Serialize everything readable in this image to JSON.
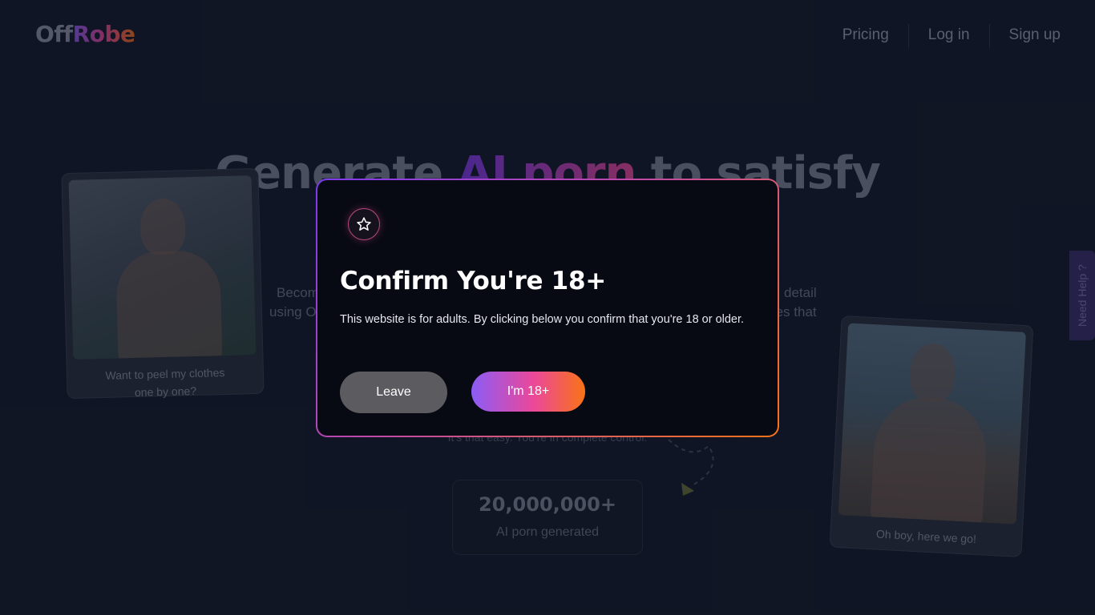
{
  "header": {
    "logo_part1": "Off",
    "logo_part2": "Robe",
    "nav": [
      {
        "label": "Pricing"
      },
      {
        "label": "Log in"
      },
      {
        "label": "Sign up"
      }
    ]
  },
  "hero": {
    "title_part1": "Generate ",
    "title_highlight": "AI porn",
    "title_part2": " to satisfy",
    "sub_left_line1": "Becom",
    "sub_left_line2": "using O",
    "sub_right_line1": "detail",
    "sub_right_line2": "ges that",
    "small_text": "It's that easy. You're in complete control."
  },
  "stat": {
    "value": "20,000,000+",
    "label": "AI porn generated"
  },
  "cards": {
    "left_caption_line1": "Want to peel my clothes",
    "left_caption_line2": "one by one?",
    "right_caption": "Oh boy, here we go!"
  },
  "help_tab": {
    "label": "Need Help ?"
  },
  "modal": {
    "icon": "star-icon",
    "title": "Confirm You're 18+",
    "text": "This website is for adults. By clicking below you confirm that you're 18 or older.",
    "leave_label": "Leave",
    "confirm_label": "I'm 18+"
  },
  "colors": {
    "background": "#151b2c",
    "modal_bg": "#070a13",
    "accent_purple": "#8b5cf6",
    "accent_pink": "#ec4899",
    "accent_orange": "#f97316",
    "leave_button": "#5c5c60"
  }
}
